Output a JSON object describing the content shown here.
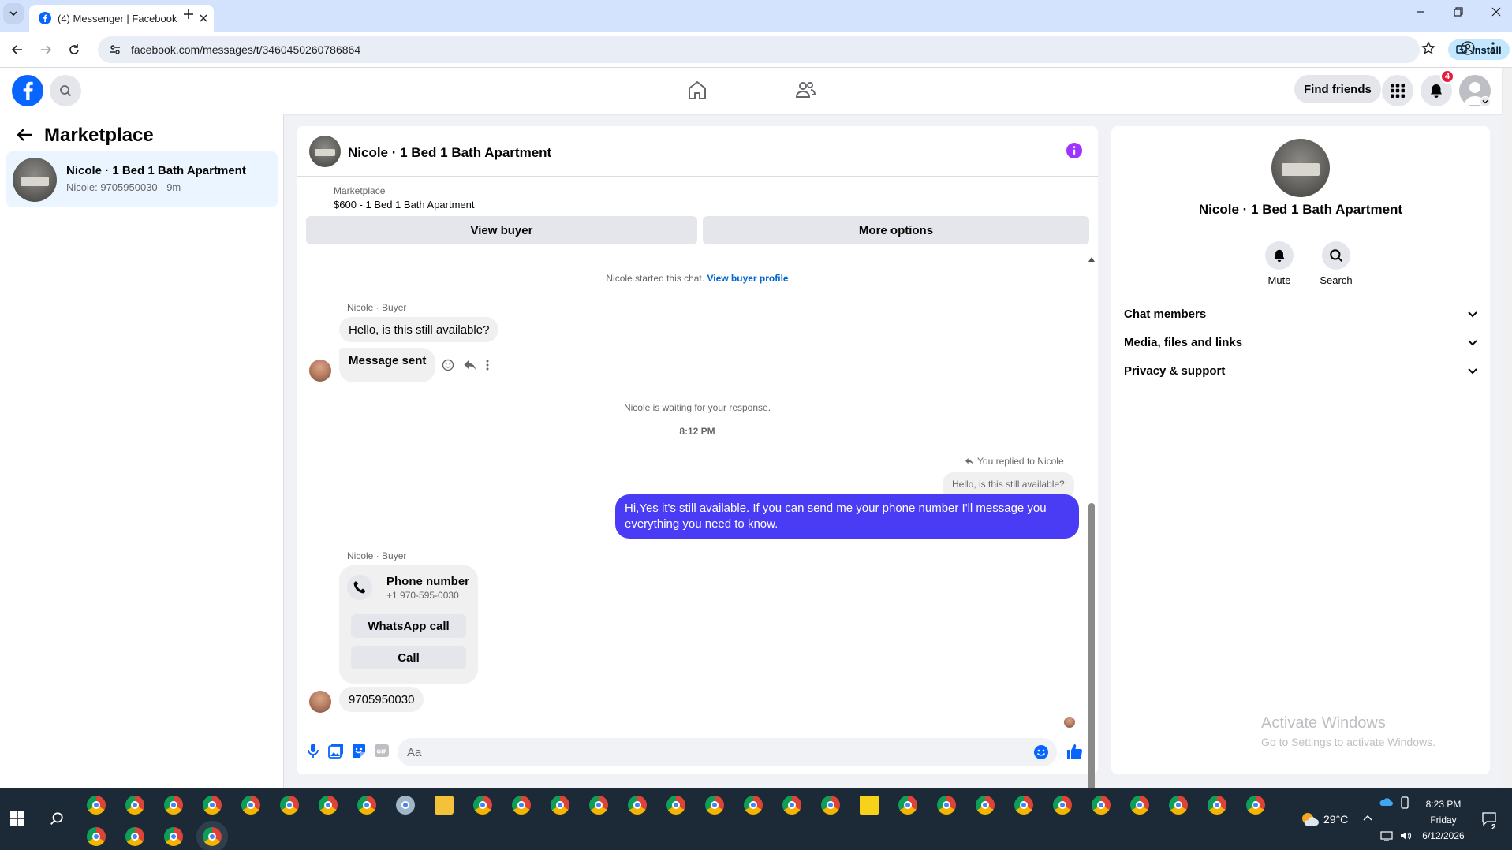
{
  "browser": {
    "tab_title": "(4) Messenger | Facebook",
    "url": "facebook.com/messages/t/3460450260786864",
    "install_label": "Install"
  },
  "header": {
    "find_friends_label": "Find friends",
    "notifications_count": "4"
  },
  "sidebar": {
    "title": "Marketplace",
    "conversations": [
      {
        "name": "Nicole · 1 Bed 1 Bath Apartment",
        "preview": "Nicole: 9705950030 · 9m"
      }
    ]
  },
  "chat": {
    "title": "Nicole · 1 Bed 1 Bath Apartment",
    "listing": {
      "source": "Marketplace",
      "summary": "$600 - 1 Bed 1 Bath Apartment"
    },
    "view_buyer_label": "View buyer",
    "more_options_label": "More options",
    "started_notice": "Nicole started this chat.",
    "view_buyer_profile_link": "View buyer profile",
    "sender_label_1": "Nicole · Buyer",
    "msg_1": "Hello, is this still available?",
    "msg_2": "Message sent",
    "waiting_notice": "Nicole is waiting for your response.",
    "timestamp": "8:12 PM",
    "replied_to": "You replied to Nicole",
    "quoted_reply": "Hello, is this still available?",
    "outgoing_msg": "Hi,Yes it's still available. If you can send me your phone number I'll message you everything you need to know.",
    "sender_label_2": "Nicole · Buyer",
    "phone_card": {
      "title": "Phone number",
      "number": "+1 970-595-0030",
      "whatsapp_label": "WhatsApp call",
      "call_label": "Call"
    },
    "msg_last": "9705950030",
    "composer_placeholder": "Aa"
  },
  "info_panel": {
    "title": "Nicole · 1 Bed 1 Bath Apartment",
    "mute_label": "Mute",
    "search_label": "Search",
    "sections": [
      "Chat members",
      "Media, files and links",
      "Privacy & support"
    ]
  },
  "watermark": {
    "line1": "Activate Windows",
    "line2": "Go to Settings to activate Windows."
  },
  "taskbar": {
    "weather": "29°C",
    "time": "8:23 PM",
    "day": "Friday",
    "date": "6/12/2026",
    "notification_count": "2"
  },
  "colors": {
    "fb_blue": "#0866ff",
    "messenger_bubble": "#4a3cf5",
    "link_blue": "#0064d1",
    "info_purple": "#a033ff"
  }
}
